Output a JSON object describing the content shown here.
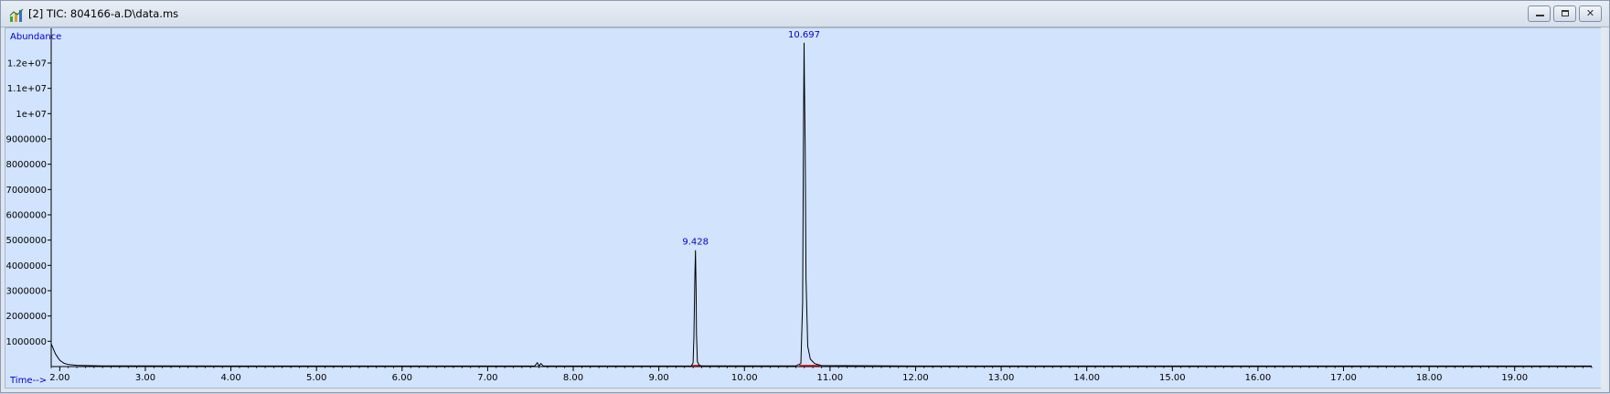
{
  "window": {
    "title": "[2] TIC: 804166-a.D\\data.ms",
    "icon": "chromatogram-app-icon",
    "buttons": {
      "minimize": "minimize-icon",
      "restore": "restore-icon",
      "close": "close-icon"
    }
  },
  "colors": {
    "plot_bg": "#d2e3fd",
    "trace": "#000000",
    "peak_label": "#0000cc",
    "baseline_marker": "#cc0000"
  },
  "chart_data": {
    "type": "line",
    "title": "",
    "ylabel": "Abundance",
    "xlabel": "Time-->",
    "xlim": [
      1.9,
      19.9
    ],
    "ylim": [
      0,
      13300000
    ],
    "x_ticks": [
      2.0,
      3.0,
      4.0,
      5.0,
      6.0,
      7.0,
      8.0,
      9.0,
      10.0,
      11.0,
      12.0,
      13.0,
      14.0,
      15.0,
      16.0,
      17.0,
      18.0,
      19.0
    ],
    "x_tick_labels": [
      "2.00",
      "3.00",
      "4.00",
      "5.00",
      "6.00",
      "7.00",
      "8.00",
      "9.00",
      "10.00",
      "11.00",
      "12.00",
      "13.00",
      "14.00",
      "15.00",
      "16.00",
      "17.00",
      "18.00",
      "19.00"
    ],
    "y_ticks": [
      1000000,
      2000000,
      3000000,
      4000000,
      5000000,
      6000000,
      7000000,
      8000000,
      9000000,
      10000000,
      11000000,
      12000000
    ],
    "y_tick_labels": [
      "1000000",
      "2000000",
      "3000000",
      "4000000",
      "5000000",
      "6000000",
      "7000000",
      "8000000",
      "9000000",
      "1e+07",
      "1.1e+07",
      "1.2e+07"
    ],
    "grid": false,
    "series": [
      {
        "x": [
          1.9,
          1.95,
          2.0,
          2.05,
          2.1,
          2.2,
          2.3,
          2.5,
          3.0,
          5.0,
          7.55,
          7.58,
          7.6,
          7.62,
          7.65,
          9.38,
          9.4,
          9.41,
          9.42,
          9.428,
          9.435,
          9.44,
          9.45,
          9.47,
          9.5,
          10.6,
          10.66,
          10.68,
          10.69,
          10.697,
          10.7,
          10.71,
          10.72,
          10.74,
          10.77,
          10.82,
          10.9,
          12.0,
          19.9
        ],
        "y": [
          900000,
          500000,
          250000,
          130000,
          80000,
          50000,
          40000,
          30000,
          25000,
          20000,
          20000,
          150000,
          20000,
          120000,
          20000,
          20000,
          150000,
          1200000,
          3500000,
          4600000,
          3000000,
          1300000,
          200000,
          60000,
          25000,
          25000,
          120000,
          2500000,
          9000000,
          12800000,
          11500000,
          8700000,
          3500000,
          800000,
          300000,
          120000,
          40000,
          20000,
          20000
        ]
      }
    ],
    "peak_labels": [
      {
        "x": 9.428,
        "y": 4600000,
        "text": "9.428"
      },
      {
        "x": 10.697,
        "y": 12800000,
        "text": "10.697"
      }
    ],
    "baseline_markers": [
      {
        "x1": 9.39,
        "x2": 9.49
      },
      {
        "x1": 10.64,
        "x2": 10.88
      }
    ]
  }
}
